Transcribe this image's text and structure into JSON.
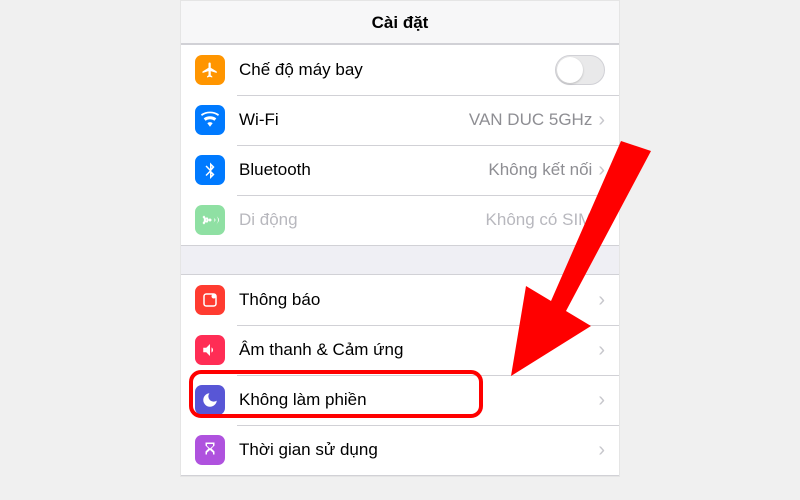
{
  "header": {
    "title": "Cài đặt"
  },
  "group1": {
    "airplane": {
      "label": "Chế độ máy bay",
      "toggled": false
    },
    "wifi": {
      "label": "Wi-Fi",
      "detail": "VAN DUC 5GHz"
    },
    "bluetooth": {
      "label": "Bluetooth",
      "detail": "Không kết nối"
    },
    "cellular": {
      "label": "Di động",
      "detail": "Không có SIM"
    }
  },
  "group2": {
    "notifications": {
      "label": "Thông báo"
    },
    "sounds": {
      "label": "Âm thanh & Cảm ứng"
    },
    "dnd": {
      "label": "Không làm phiền"
    },
    "screentime": {
      "label": "Thời gian sử dụng"
    }
  },
  "annotation": {
    "highlight_target": "dnd"
  }
}
